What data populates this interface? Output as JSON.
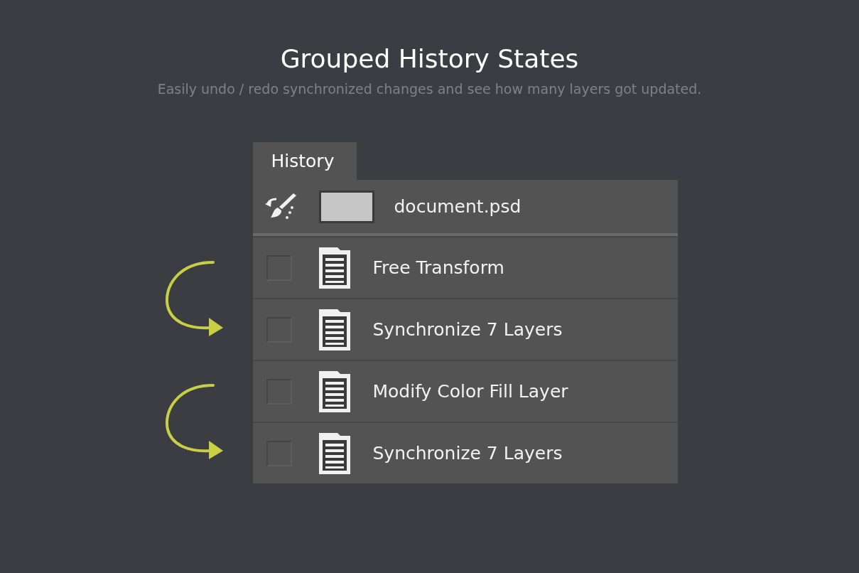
{
  "header": {
    "title": "Grouped History States",
    "subtitle": "Easily undo / redo synchronized changes and see how many layers got updated."
  },
  "panel": {
    "tab": {
      "label": "History",
      "selected": true
    },
    "snapshot": {
      "label": "document.psd"
    },
    "states": [
      {
        "label": "Free Transform",
        "checked": false
      },
      {
        "label": "Synchronize 7 Layers",
        "checked": false
      },
      {
        "label": "Modify Color Fill Layer",
        "checked": false
      },
      {
        "label": "Synchronize 7 Layers",
        "checked": false
      }
    ]
  }
}
